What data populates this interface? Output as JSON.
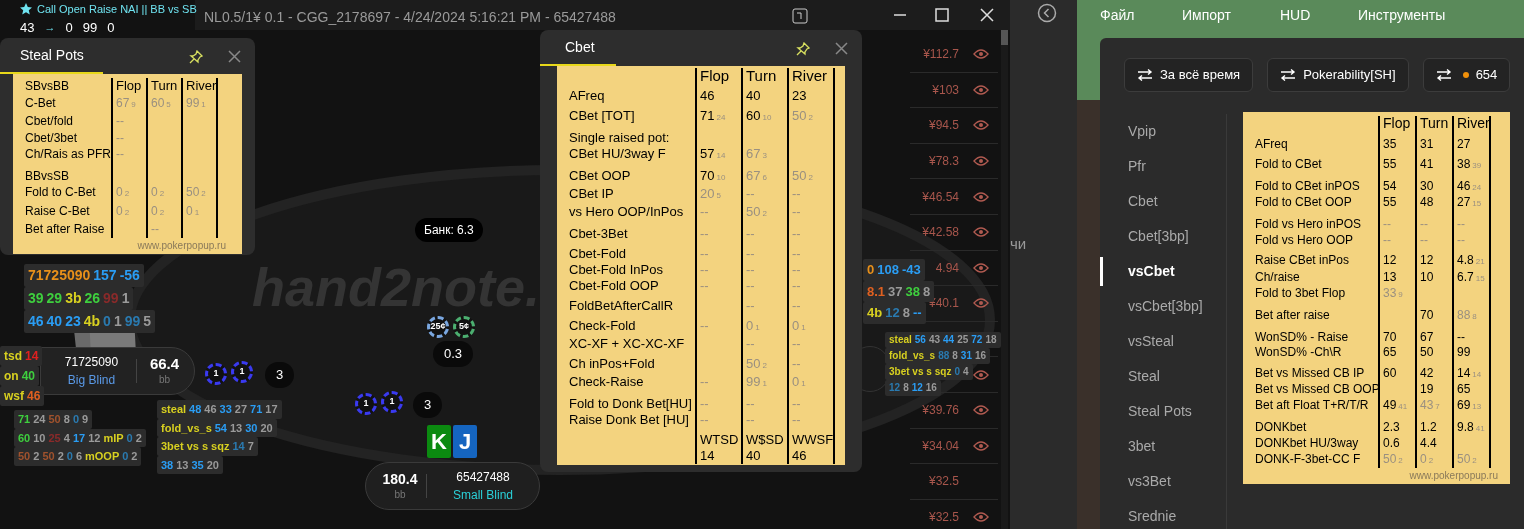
{
  "table_window": {
    "title": "NL0.5/1¥ 0.1 - CGG_2178697 - 4/24/2024 5:16:21 PM - 65427488",
    "logo": "hand2note.",
    "pot": "Банк: 6.3"
  },
  "note": {
    "title": "Call Open Raise NAI || BB vs SB",
    "from": "43",
    "arrow": "→",
    "to": [
      "0",
      "99",
      "0"
    ]
  },
  "popups": [
    {
      "tab": {
        "label": "Steal Pots",
        "selected": true
      },
      "table": {
        "corner": "SBvsBB",
        "columns": [
          "Flop",
          "Turn",
          "River"
        ],
        "groups": [
          [
            {
              "label": "C-Bet",
              "cells": [
                {
                  "v": "67",
                  "n": "9",
                  "faded": true
                },
                {
                  "v": "60",
                  "n": "5",
                  "faded": true
                },
                {
                  "v": "99",
                  "n": "1",
                  "faded": true
                }
              ]
            },
            {
              "label": "Cbet/fold",
              "cells": [
                {
                  "v": "--",
                  "faded": true
                },
                null,
                null
              ]
            },
            {
              "label": "Cbet/3bet",
              "cells": [
                {
                  "v": "--",
                  "faded": true
                },
                null,
                null
              ]
            },
            {
              "label": "Ch/Rais as PFR",
              "cells": [
                {
                  "v": "--",
                  "faded": true
                },
                null,
                null
              ]
            }
          ],
          [
            {
              "label": "BBvsSB",
              "cells": [
                null,
                null,
                null
              ]
            },
            {
              "label": "Fold to C-Bet",
              "cells": [
                {
                  "v": "0",
                  "n": "2",
                  "faded": true
                },
                {
                  "v": "0",
                  "n": "2",
                  "faded": true
                },
                {
                  "v": "50",
                  "n": "2",
                  "faded": true
                }
              ]
            },
            {
              "label": "Raise C-Bet",
              "cells": [
                {
                  "v": "0",
                  "n": "2",
                  "faded": true
                },
                {
                  "v": "0",
                  "n": "2",
                  "faded": true
                },
                {
                  "v": "0",
                  "n": "1",
                  "faded": true
                }
              ]
            },
            {
              "label": "Bet after Raise",
              "cells": [
                null,
                {
                  "v": "--",
                  "faded": true
                },
                null
              ]
            }
          ]
        ],
        "footer": "www.pokerpopup.ru"
      }
    },
    {
      "tab": {
        "label": "Cbet",
        "selected": true
      },
      "table": {
        "columns": [
          "Flop",
          "Turn",
          "River"
        ],
        "groups": [
          [
            {
              "label": "AFreq",
              "cells": [
                {
                  "v": "46",
                  "faded": false
                },
                {
                  "v": "40",
                  "faded": false
                },
                {
                  "v": "23",
                  "faded": false
                }
              ]
            }
          ],
          [
            {
              "label": "CBet [TOT]",
              "cells": [
                {
                  "v": "71",
                  "n": "24",
                  "faded": false
                },
                {
                  "v": "60",
                  "n": "10",
                  "faded": false
                },
                {
                  "v": "50",
                  "n": "2",
                  "faded": true
                }
              ]
            }
          ],
          [
            {
              "label": "Single raised pot:",
              "cells": [
                null,
                null,
                null
              ]
            },
            {
              "label": "CBet HU/3way F",
              "cells": [
                {
                  "v": "57",
                  "n": "14",
                  "faded": false
                },
                {
                  "v": "67",
                  "n": "3",
                  "faded": true
                },
                null
              ]
            }
          ],
          [
            {
              "label": "CBet OOP",
              "cells": [
                {
                  "v": "70",
                  "n": "10",
                  "faded": false
                },
                {
                  "v": "67",
                  "n": "6",
                  "faded": true
                },
                {
                  "v": "50",
                  "n": "2",
                  "faded": true
                }
              ]
            },
            {
              "label": "CBet IP",
              "cells": [
                {
                  "v": "20",
                  "n": "5",
                  "faded": true
                },
                {
                  "v": "--",
                  "faded": true
                },
                {
                  "v": "--",
                  "faded": true
                }
              ]
            },
            {
              "label": "vs Hero OOP/InPos",
              "cells": [
                {
                  "v": "--",
                  "faded": true
                },
                {
                  "v": "50",
                  "n": "2",
                  "faded": true
                },
                {
                  "v": "--",
                  "faded": true
                }
              ]
            }
          ],
          [
            {
              "label": "Cbet-3Bet",
              "cells": [
                {
                  "v": "--",
                  "faded": true
                },
                {
                  "v": "--",
                  "faded": true
                },
                {
                  "v": "--",
                  "faded": true
                }
              ]
            }
          ],
          [
            {
              "label": "Cbet-Fold",
              "cells": [
                {
                  "v": "--",
                  "faded": true
                },
                {
                  "v": "--",
                  "faded": true
                },
                {
                  "v": "--",
                  "faded": true
                }
              ]
            },
            {
              "label": "Cbet-Fold InPos",
              "cells": [
                {
                  "v": "--",
                  "faded": true
                },
                {
                  "v": "--",
                  "faded": true
                },
                {
                  "v": "--",
                  "faded": true
                }
              ]
            },
            {
              "label": "Cbet-Fold OOP",
              "cells": [
                {
                  "v": "--",
                  "faded": true
                },
                {
                  "v": "--",
                  "faded": true
                },
                {
                  "v": "--",
                  "faded": true
                }
              ]
            }
          ],
          [
            {
              "label": "FoldBetAfterCallR",
              "cells": [
                null,
                {
                  "v": "--",
                  "faded": true
                },
                {
                  "v": "--",
                  "faded": true
                }
              ]
            }
          ],
          [
            {
              "label": "Check-Fold",
              "cells": [
                {
                  "v": "--",
                  "faded": true
                },
                {
                  "v": "0",
                  "n": "1",
                  "faded": true
                },
                {
                  "v": "0",
                  "n": "1",
                  "faded": true
                }
              ]
            },
            {
              "label": "XC-XF + XC-XC-XF",
              "cells": [
                null,
                {
                  "v": "--",
                  "faded": true
                },
                {
                  "v": "--",
                  "faded": true
                }
              ]
            }
          ],
          [
            {
              "label": "Ch inPos+Fold",
              "cells": [
                null,
                {
                  "v": "50",
                  "n": "2",
                  "faded": true
                },
                {
                  "v": "--",
                  "faded": true
                }
              ]
            },
            {
              "label": "Check-Raise",
              "cells": [
                {
                  "v": "--",
                  "faded": true
                },
                {
                  "v": "99",
                  "n": "1",
                  "faded": true
                },
                {
                  "v": "0",
                  "n": "1",
                  "faded": true
                }
              ]
            }
          ],
          [
            {
              "label": "Fold to Donk Bet[HU]",
              "cells": [
                {
                  "v": "--",
                  "faded": true
                },
                {
                  "v": "--",
                  "faded": true
                },
                {
                  "v": "--",
                  "faded": true
                }
              ]
            },
            {
              "label": "Raise Donk Bet [HU]",
              "cells": [
                {
                  "v": "--",
                  "faded": true
                },
                {
                  "v": "--",
                  "faded": true
                },
                {
                  "v": "--",
                  "faded": true
                }
              ]
            }
          ],
          [
            {
              "cells": [
                {
                  "v": "WTSD",
                  "faded": false
                },
                {
                  "v": "W$SD",
                  "faded": false
                },
                {
                  "v": "WWSF",
                  "faded": false
                }
              ]
            },
            {
              "cells": [
                {
                  "v": "14",
                  "faded": false
                },
                {
                  "v": "40",
                  "faded": false
                },
                {
                  "v": "46",
                  "faded": false
                }
              ]
            }
          ]
        ]
      }
    }
  ],
  "seats": [
    {
      "name": "71725090",
      "position": "Big Blind",
      "stack": "66.4",
      "unit": "bb",
      "chips": [
        "1",
        "1"
      ],
      "bet": "3"
    },
    {
      "name": "65427488",
      "position": "Small Blind",
      "stack": "180.4",
      "unit": "bb",
      "chips": [
        "1",
        "1"
      ],
      "bet": "3",
      "cards": [
        {
          "rank": "K",
          "color": "#0b8a10"
        },
        {
          "rank": "J",
          "color": "#1565c0"
        }
      ]
    }
  ],
  "pot_chips": {
    "chips": [
      {
        "label": "25¢",
        "color": "#7aa7e0"
      },
      {
        "label": "5¢",
        "color": "#4caf70"
      }
    ],
    "amount": "0.3"
  },
  "huds": [
    {
      "lines": [
        [
          {
            "t": "71725090",
            "color": "#e8901a"
          },
          {
            "t": "157",
            "color": "#2a9df4"
          },
          {
            "t": "-56",
            "color": "#2a9df4"
          }
        ],
        [
          {
            "t": "39",
            "color": "#3ecf3e"
          },
          {
            "t": "29",
            "color": "#3ecf3e"
          },
          {
            "t": "3b",
            "color": "#d8d020"
          },
          {
            "t": "26",
            "color": "#3ecf3e"
          },
          {
            "t": "99",
            "color": "#8a2a2a"
          },
          {
            "t": "1",
            "color": "#9a9a9a"
          }
        ],
        [
          {
            "t": "46",
            "color": "#2a9df4"
          },
          {
            "t": "40",
            "color": "#2a9df4"
          },
          {
            "t": "23",
            "color": "#2a9df4"
          },
          {
            "t": "4b",
            "color": "#d8d020"
          },
          {
            "t": "0",
            "color": "#2a7ab0"
          },
          {
            "t": "1",
            "color": "#9a9a9a"
          },
          {
            "t": "99",
            "color": "#2a7ab0"
          },
          {
            "t": "5",
            "color": "#9a9a9a"
          }
        ]
      ]
    },
    {
      "lines": [
        [
          {
            "t": "tsd",
            "color": "#d8d020"
          },
          {
            "t": "14",
            "color": "#e02020"
          }
        ],
        [
          {
            "t": "on",
            "color": "#d8d020"
          },
          {
            "t": "40",
            "color": "#3ecf3e"
          }
        ],
        [
          {
            "t": "wsf",
            "color": "#d8d020"
          },
          {
            "t": "46",
            "color": "#e06020"
          }
        ]
      ]
    },
    {
      "lines": [
        [
          {
            "t": "71",
            "color": "#3ecf3e"
          },
          {
            "t": "24",
            "color": "#9a9a9a"
          },
          {
            "t": "50",
            "color": "#a0522d"
          },
          {
            "t": "8",
            "color": "#9a9a9a"
          },
          {
            "t": "0",
            "color": "#2a7ab0"
          },
          {
            "t": "9",
            "color": "#9a9a9a"
          }
        ],
        [
          {
            "t": "60",
            "color": "#3ecf3e"
          },
          {
            "t": "10",
            "color": "#9a9a9a"
          },
          {
            "t": "25",
            "color": "#8a2a2a"
          },
          {
            "t": "4",
            "color": "#9a9a9a"
          },
          {
            "t": "17",
            "color": "#2a9df4"
          },
          {
            "t": "12",
            "color": "#9a9a9a"
          },
          {
            "t": "mIP",
            "color": "#d8d020"
          },
          {
            "t": "0",
            "color": "#2a7ab0"
          },
          {
            "t": "2",
            "color": "#9a9a9a"
          }
        ],
        [
          {
            "t": "50",
            "color": "#a0522d"
          },
          {
            "t": "2",
            "color": "#9a9a9a"
          },
          {
            "t": "50",
            "color": "#a0522d"
          },
          {
            "t": "2",
            "color": "#9a9a9a"
          },
          {
            "t": "0",
            "color": "#2a7ab0"
          },
          {
            "t": "6",
            "color": "#9a9a9a"
          },
          {
            "t": "mOOP",
            "color": "#d8d020"
          },
          {
            "t": "0",
            "color": "#2a7ab0"
          },
          {
            "t": "2",
            "color": "#9a9a9a"
          }
        ]
      ]
    },
    {
      "lines": [
        [
          {
            "t": "steal",
            "color": "#d8d020"
          },
          {
            "t": "48",
            "color": "#2a9df4"
          },
          {
            "t": "46",
            "color": "#9a9a9a"
          },
          {
            "t": "33",
            "color": "#2a9df4"
          },
          {
            "t": "27",
            "color": "#9a9a9a"
          },
          {
            "t": "71",
            "color": "#2a9df4"
          },
          {
            "t": "17",
            "color": "#9a9a9a"
          }
        ],
        [
          {
            "t": "fold_vs_s",
            "color": "#d8d020"
          },
          {
            "t": "54",
            "color": "#2a9df4"
          },
          {
            "t": "13",
            "color": "#9a9a9a"
          },
          {
            "t": "30",
            "color": "#2a9df4"
          },
          {
            "t": "20",
            "color": "#9a9a9a"
          }
        ],
        [
          {
            "t": "3bet vs s",
            "color": "#d8d020"
          },
          {
            "t": "sqz",
            "color": "#d8d020"
          },
          {
            "t": "14",
            "color": "#2a7ab0"
          },
          {
            "t": "7",
            "color": "#9a9a9a"
          }
        ],
        [
          {
            "t": "38",
            "color": "#2a9df4"
          },
          {
            "t": "13",
            "color": "#9a9a9a"
          },
          {
            "t": "35",
            "color": "#2a9df4"
          },
          {
            "t": "20",
            "color": "#9a9a9a"
          }
        ]
      ]
    },
    {
      "lines": [
        [
          {
            "t": "0",
            "color": "#e8901a"
          },
          {
            "t": "108",
            "color": "#2a9df4"
          },
          {
            "t": "-43",
            "color": "#2a9df4"
          }
        ],
        [
          {
            "t": "8.1",
            "color": "#e06020"
          },
          {
            "t": "37",
            "color": "#9a9a9a"
          },
          {
            "t": "38",
            "color": "#3ecf3e"
          },
          {
            "t": "8",
            "color": "#9a9a9a"
          }
        ],
        [
          {
            "t": "4b",
            "color": "#d8d020"
          },
          {
            "t": "12",
            "color": "#2a7ab0"
          },
          {
            "t": "8",
            "color": "#9a9a9a"
          },
          {
            "t": "--",
            "color": "#2a9df4"
          }
        ]
      ]
    },
    {
      "lines": [
        [
          {
            "t": "steal",
            "color": "#d8d020"
          },
          {
            "t": "56",
            "color": "#2a9df4"
          },
          {
            "t": "43",
            "color": "#9a9a9a"
          },
          {
            "t": "44",
            "color": "#2a9df4"
          },
          {
            "t": "25",
            "color": "#9a9a9a"
          },
          {
            "t": "72",
            "color": "#2a9df4"
          },
          {
            "t": "18",
            "color": "#9a9a9a"
          }
        ],
        [
          {
            "t": "fold_vs_s",
            "color": "#d8d020"
          },
          {
            "t": "88",
            "color": "#2a7ab0"
          },
          {
            "t": "8",
            "color": "#9a9a9a"
          },
          {
            "t": "31",
            "color": "#2a9df4"
          },
          {
            "t": "16",
            "color": "#9a9a9a"
          }
        ],
        [
          {
            "t": "3bet vs s",
            "color": "#d8d020"
          },
          {
            "t": "sqz",
            "color": "#d8d020"
          },
          {
            "t": "0",
            "color": "#2a7ab0"
          },
          {
            "t": "4",
            "color": "#9a9a9a"
          }
        ],
        [
          {
            "t": "12",
            "color": "#2a7ab0"
          },
          {
            "t": "8",
            "color": "#9a9a9a"
          },
          {
            "t": "12",
            "color": "#2a9df4"
          },
          {
            "t": "16",
            "color": "#9a9a9a"
          }
        ]
      ]
    }
  ],
  "price_list": [
    {
      "price": "¥112.7",
      "eye": true
    },
    {
      "price": "¥103",
      "eye": true
    },
    {
      "price": "¥94.5",
      "eye": true
    },
    {
      "price": "¥78.3",
      "eye": true
    },
    {
      "price": "¥46.54",
      "eye": true
    },
    {
      "price": "¥42.58",
      "eye": true
    },
    {
      "price": "4.94",
      "eye": true
    },
    {
      "price": "¥40.1",
      "eye": true
    },
    {
      "eye": false
    },
    {
      "eye": true
    },
    {
      "price": "¥39.76",
      "eye": true
    },
    {
      "price": "¥34.04",
      "eye": true
    },
    {
      "price": "¥32.5",
      "eye": false
    },
    {
      "price": "¥32.5",
      "eye": true
    }
  ],
  "app": {
    "side_text": "чи",
    "menu": [
      "Файл",
      "Импорт",
      "HUD",
      "Инструменты"
    ],
    "filters": [
      {
        "label": "За всё время"
      },
      {
        "label": "Pokerability[SH]"
      },
      {
        "label": "654",
        "color": "#f0900a"
      }
    ],
    "sidebar": [
      {
        "label": "Vpip",
        "selected": false
      },
      {
        "label": "Pfr",
        "selected": false
      },
      {
        "label": "Cbet",
        "selected": false
      },
      {
        "label": "Cbet[3bp]",
        "selected": false
      },
      {
        "label": "vsCbet",
        "selected": true
      },
      {
        "label": "vsCbet[3bp]",
        "selected": false
      },
      {
        "label": "vsSteal",
        "selected": false
      },
      {
        "label": "Steal",
        "selected": false
      },
      {
        "label": "Steal Pots",
        "selected": false
      },
      {
        "label": "3bet",
        "selected": false
      },
      {
        "label": "vs3Bet",
        "selected": false
      },
      {
        "label": "Srednie",
        "selected": false
      }
    ],
    "stats_table": {
      "columns": [
        "Flop",
        "Turn",
        "River"
      ],
      "groups": [
        [
          {
            "label": "AFreq",
            "cells": [
              {
                "v": "35",
                "faded": false
              },
              {
                "v": "31",
                "faded": false
              },
              {
                "v": "27",
                "faded": false
              }
            ]
          }
        ],
        [
          {
            "label": "Fold to CBet",
            "cells": [
              {
                "v": "55",
                "faded": false
              },
              {
                "v": "41",
                "faded": false
              },
              {
                "v": "38",
                "n": "39",
                "faded": false
              }
            ]
          }
        ],
        [
          {
            "label": "Fold to CBet inPOS",
            "cells": [
              {
                "v": "54",
                "faded": false
              },
              {
                "v": "30",
                "faded": false
              },
              {
                "v": "46",
                "n": "24",
                "faded": false
              }
            ]
          },
          {
            "label": "Fold to CBet OOP",
            "cells": [
              {
                "v": "55",
                "faded": false
              },
              {
                "v": "48",
                "faded": false
              },
              {
                "v": "27",
                "n": "15",
                "faded": false
              }
            ]
          }
        ],
        [
          {
            "label": "Fold vs Hero inPOS",
            "cells": [
              {
                "v": "--",
                "faded": true
              },
              {
                "v": "--",
                "faded": true
              },
              {
                "v": "--",
                "faded": true
              }
            ]
          },
          {
            "label": "Fold vs Hero OOP",
            "cells": [
              {
                "v": "--",
                "faded": true
              },
              {
                "v": "--",
                "faded": true
              },
              {
                "v": "--",
                "faded": true
              }
            ]
          }
        ],
        [
          {
            "label": "Raise CBet inPos",
            "cells": [
              {
                "v": "12",
                "faded": false
              },
              {
                "v": "12",
                "faded": false
              },
              {
                "v": "4.8",
                "n": "21",
                "faded": false
              }
            ]
          },
          {
            "label": "Ch/raise",
            "cells": [
              {
                "v": "13",
                "faded": false
              },
              {
                "v": "10",
                "faded": false
              },
              {
                "v": "6.7",
                "n": "15",
                "faded": false
              }
            ]
          },
          {
            "label": "Fold to 3bet Flop",
            "cells": [
              {
                "v": "33",
                "n": "9",
                "faded": true
              },
              null,
              null
            ]
          }
        ],
        [
          {
            "label": "Bet after raise",
            "cells": [
              null,
              {
                "v": "70",
                "faded": false
              },
              {
                "v": "88",
                "n": "8",
                "faded": true
              }
            ]
          }
        ],
        [
          {
            "label": "WonSD% - Raise",
            "cells": [
              {
                "v": "70",
                "faded": false
              },
              {
                "v": "67",
                "faded": false
              },
              {
                "v": "--",
                "faded": false
              }
            ]
          },
          {
            "label": "WonSD% -Ch\\R",
            "cells": [
              {
                "v": "65",
                "faded": false
              },
              {
                "v": "50",
                "faded": false
              },
              {
                "v": "99",
                "faded": false
              }
            ]
          }
        ],
        [
          {
            "label": "Bet vs Missed CB IP",
            "cells": [
              {
                "v": "60",
                "faded": false
              },
              {
                "v": "42",
                "faded": false
              },
              {
                "v": "14",
                "n": "14",
                "faded": false
              }
            ]
          },
          {
            "label": "Bet vs Missed CB OOP",
            "cells": [
              null,
              {
                "v": "19",
                "faded": false
              },
              {
                "v": "65",
                "faded": false
              }
            ]
          },
          {
            "label": "Bet aft Float T+R/T/R",
            "cells": [
              {
                "v": "49",
                "n": "41",
                "faded": false
              },
              {
                "v": "43",
                "n": "7",
                "faded": true
              },
              {
                "v": "69",
                "n": "13",
                "faded": false
              }
            ]
          }
        ],
        [
          {
            "label": "DONKbet",
            "cells": [
              {
                "v": "2.3",
                "faded": false
              },
              {
                "v": "1.2",
                "faded": false
              },
              {
                "v": "9.8",
                "n": "41",
                "faded": false
              }
            ]
          },
          {
            "label": "DONKbet HU/3way",
            "cells": [
              {
                "v": "0.6",
                "faded": false
              },
              {
                "v": "4.4",
                "faded": false
              },
              null
            ]
          },
          {
            "label": "DONK-F-3bet-CC F",
            "cells": [
              {
                "v": "50",
                "n": "2",
                "faded": true
              },
              {
                "v": "0",
                "n": "2",
                "faded": true
              },
              {
                "v": "50",
                "n": "2",
                "faded": true
              }
            ]
          }
        ]
      ],
      "footer": "www.pokerpopup.ru"
    }
  }
}
